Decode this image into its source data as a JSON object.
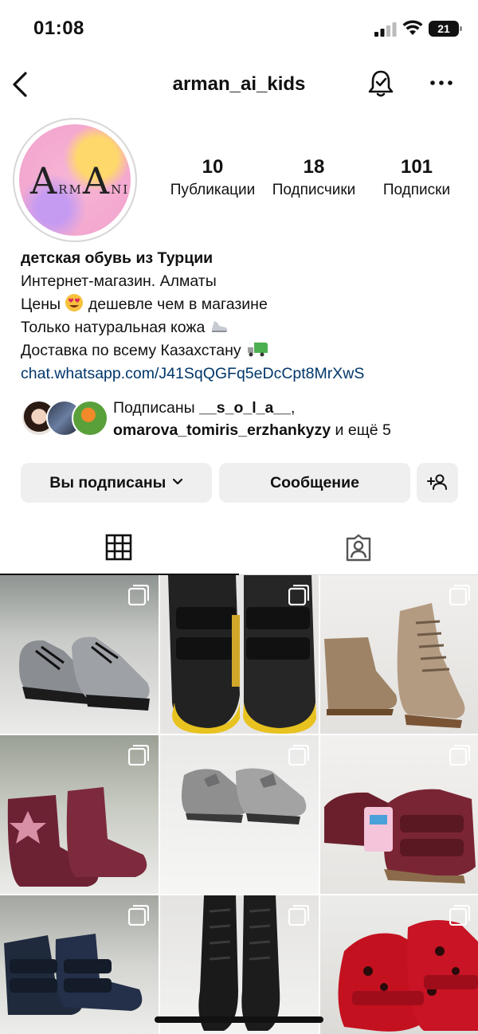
{
  "status_bar": {
    "time": "01:08",
    "battery": "21"
  },
  "nav": {
    "username": "arman_ai_kids"
  },
  "avatar": {
    "logo_text_1": "RM",
    "logo_text_2": "N",
    "logo_letter_a": "A",
    "logo_letter_a2": "A",
    "logo_i": "I"
  },
  "stats": [
    {
      "value": "10",
      "label": "Публикации"
    },
    {
      "value": "18",
      "label": "Подписчики"
    },
    {
      "value": "101",
      "label": "Подписки"
    }
  ],
  "bio": {
    "title": "детская обувь из Турции",
    "lines": [
      "Интернет-магазин. Алматы",
      "Цены",
      "дешевле чем в магазине",
      "Только натуральная кожа",
      "Доставка по всему Казахстану"
    ],
    "link": "chat.whatsapp.com/J41SqQGFq5eDcCpt8MrXwS"
  },
  "followed_by": {
    "prefix": "Подписаны",
    "user1": "__s_o_l_a__",
    "comma": ",",
    "user2": "omarova_tomiris_erzhankyzy",
    "suffix": "и ещё 5"
  },
  "buttons": {
    "following": "Вы подписаны",
    "message": "Сообщение"
  },
  "icons": {
    "back": "chevron-left-icon",
    "bell": "notification-bell-icon",
    "more": "more-dots-icon",
    "grid": "grid-icon",
    "tagged": "tagged-person-icon",
    "add_person": "add-person-icon"
  },
  "posts": [
    {
      "multi": true,
      "desc": "silver sneakers"
    },
    {
      "multi": true,
      "desc": "black yellow velcro shoes"
    },
    {
      "multi": true,
      "desc": "bronze boots"
    },
    {
      "multi": true,
      "desc": "burgundy star boots"
    },
    {
      "multi": true,
      "desc": "silver bow shoes"
    },
    {
      "multi": true,
      "desc": "burgundy suede shoes"
    },
    {
      "multi": true,
      "desc": "navy velcro boots"
    },
    {
      "multi": true,
      "desc": "black lace-up boots"
    },
    {
      "multi": true,
      "desc": "red leopard shoes"
    }
  ]
}
